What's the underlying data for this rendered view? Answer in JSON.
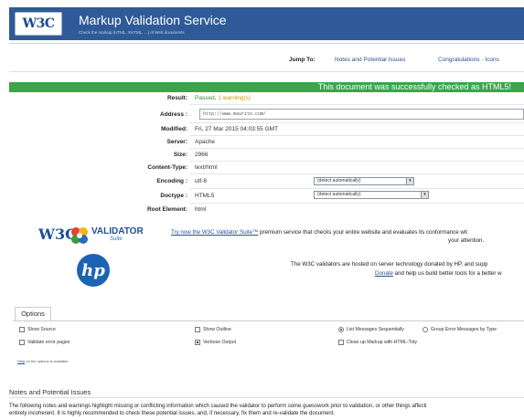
{
  "header": {
    "logo": "W3C",
    "title": "Markup Validation Service",
    "subtitle": "Check the markup (HTML, XHTML, ...) of Web documents"
  },
  "jump": {
    "label": "Jump To:",
    "links": [
      "Notes and Potential Issues",
      "Congratulations · Icons"
    ]
  },
  "banner": {
    "success": "This document was successfully checked as HTML5!",
    "color": "#3aa54a"
  },
  "result": {
    "rows": [
      {
        "label": "Result:",
        "value": "Passed, ",
        "extra": "1 warning(s)"
      },
      {
        "label": "Address :",
        "value": "http://www.maurito.com/"
      },
      {
        "label": "Modified:",
        "value": "Fri, 27 Mar 2015 04:03:55 GMT"
      },
      {
        "label": "Server:",
        "value": "Apache"
      },
      {
        "label": "Size:",
        "value": "2966"
      },
      {
        "label": "Content-Type:",
        "value": "text/html"
      },
      {
        "label": "Encoding :",
        "value": "utf-8",
        "select": "(detect automatically)"
      },
      {
        "label": "Doctype :",
        "value": "HTML5",
        "select": "(detect automatically)"
      },
      {
        "label": "Root Element:",
        "value": "html"
      }
    ]
  },
  "sponsors": {
    "validator_logo_w3c": "W3C",
    "validator_logo_word": "VALIDATOR",
    "validator_logo_suite": "Suite",
    "try_link": "Try now the W3C Validator Suite™",
    "try_rest": " premium service that checks your entire website and evaluates its conformance wit",
    "attention": "your attention.",
    "hp_logo": "hp",
    "hosted": "The W3C validators are hosted on server technology donated by HP, and supp",
    "donate_link": "Donate",
    "donate_rest": " and help us build better tools for a better w"
  },
  "options": {
    "title": "Options",
    "items": [
      {
        "label": "Show Source",
        "type": "checkbox",
        "checked": false
      },
      {
        "label": "Show Outline",
        "type": "checkbox",
        "checked": false
      },
      {
        "label": "List Messages Sequentially",
        "type": "radio",
        "checked": true
      },
      {
        "label": "Group Error Messages by Type",
        "type": "radio",
        "checked": false
      },
      {
        "label": "Validate error pages",
        "type": "checkbox",
        "checked": false
      },
      {
        "label": "Verbose Output",
        "type": "checkbox",
        "checked": true
      },
      {
        "label": "Clean up Markup with HTML-Tidy",
        "type": "checkbox",
        "checked": false
      }
    ],
    "help_link": "Help",
    "help_rest": " on the options is available."
  },
  "notes": {
    "heading": "Notes and Potential Issues",
    "line1": "The following notes and warnings highlight missing or conflicting information which caused the validator to perform some guesswork prior to validation, or other things affecti",
    "line2": "entirely incoherent. It is highly recommended to check these potential issues, and, if necessary, fix them and re-validate the document."
  }
}
